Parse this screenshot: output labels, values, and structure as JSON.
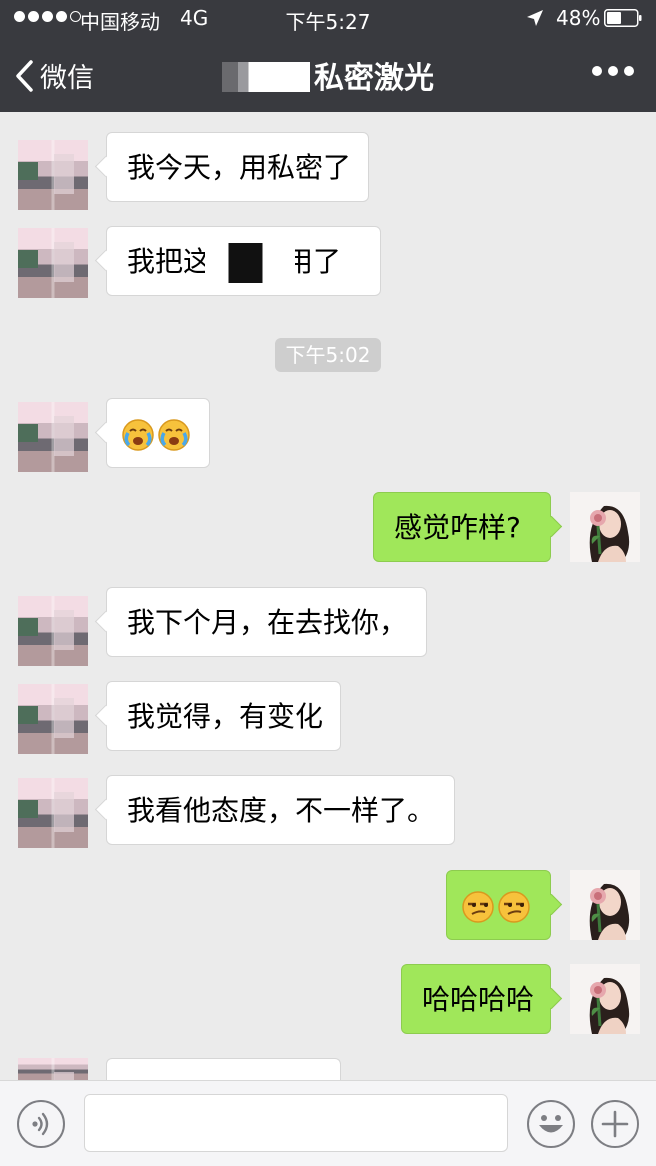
{
  "status_bar": {
    "carrier": "中国移动",
    "network": "4G",
    "time": "下午5:27",
    "battery": "48%"
  },
  "nav": {
    "back_label": "微信",
    "title": "私密激光"
  },
  "messages": [
    {
      "side": "left",
      "text": "我今天，用私密了"
    },
    {
      "side": "left",
      "text_before": "我把这",
      "text_after": "用了"
    },
    {
      "side": "time",
      "text": "下午5:02"
    },
    {
      "side": "left",
      "emoji": [
        "crying-face",
        "crying-face"
      ]
    },
    {
      "side": "right",
      "text": "感觉咋样?"
    },
    {
      "side": "left",
      "text": "我下个月，在去找你，"
    },
    {
      "side": "left",
      "text": "我觉得，有变化"
    },
    {
      "side": "left",
      "text": "我看他态度，不一样了。"
    },
    {
      "side": "right",
      "emoji": [
        "smirk-face",
        "smirk-face"
      ]
    },
    {
      "side": "right",
      "text": "哈哈哈哈"
    }
  ],
  "input": {
    "value": "",
    "placeholder": ""
  },
  "icons": [
    "back-chevron-icon",
    "more-icon",
    "voice-icon",
    "emoji-icon",
    "plus-icon",
    "location-arrow-icon",
    "battery-icon"
  ]
}
